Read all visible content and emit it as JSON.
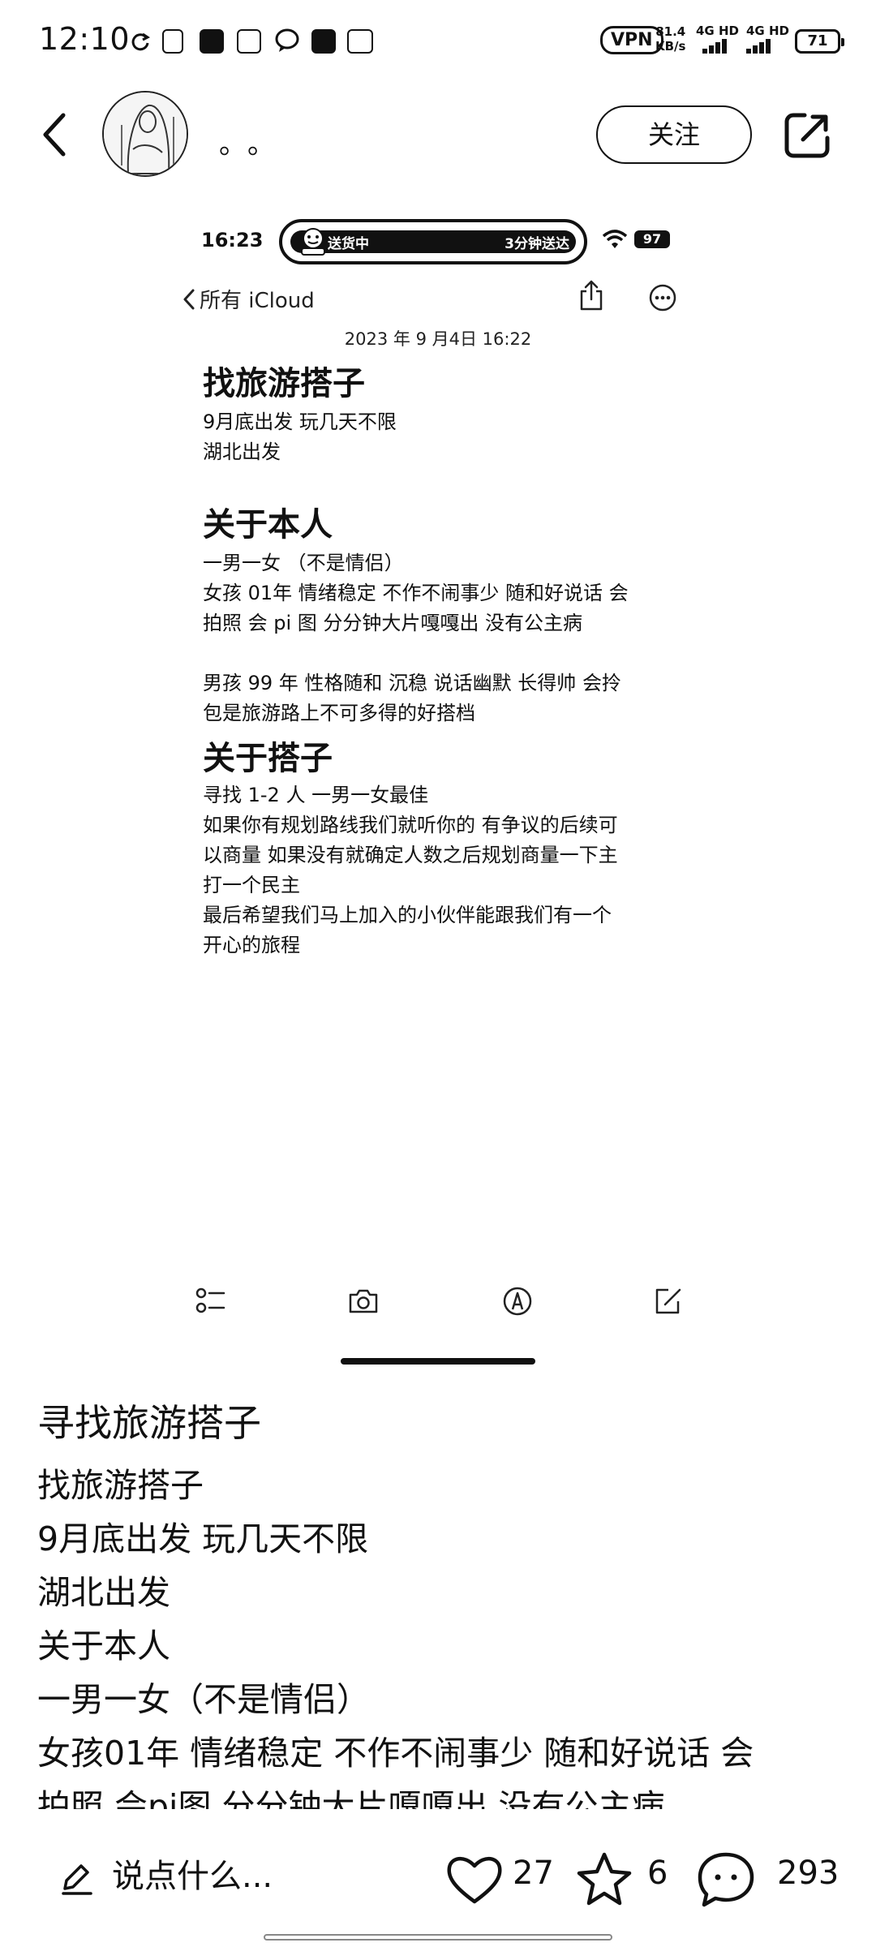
{
  "status_bar": {
    "time": "12:10",
    "vpn": "VPN",
    "speed_value": "81.4",
    "speed_unit": "KB/s",
    "net1": "4G HD",
    "net2": "4G HD",
    "battery": "71"
  },
  "header": {
    "author_name": "。。",
    "follow_label": "关注"
  },
  "inner_screenshot": {
    "time": "16:23",
    "island_left": "送货中",
    "island_right": "3分钟送达",
    "battery": "97",
    "back_label": "所有 iCloud",
    "date": "2023 年 9 月4日 16:22",
    "sections": [
      {
        "heading": "找旅游搭子",
        "lines": [
          "9月底出发 玩几天不限",
          "湖北出发"
        ]
      },
      {
        "heading": "关于本人",
        "lines": [
          "一男一女 （不是情侣）",
          "女孩 01年 情绪稳定 不作不闹事少 随和好说话 会",
          "拍照 会 pi 图 分分钟大片嘎嘎出 没有公主病",
          "",
          "男孩 99 年 性格随和 沉稳 说话幽默 长得帅 会拎",
          "包是旅游路上不可多得的好搭档"
        ]
      },
      {
        "heading": "关于搭子",
        "lines": [
          "寻找 1-2 人 一男一女最佳",
          "如果你有规划路线我们就听你的 有争议的后续可",
          "以商量 如果没有就确定人数之后规划商量一下主",
          "打一个民主",
          "最后希望我们马上加入的小伙伴能跟我们有一个",
          "开心的旅程"
        ]
      }
    ]
  },
  "post": {
    "title": "寻找旅游搭子",
    "body_lines": [
      "找旅游搭子",
      "9月底出发 玩几天不限",
      "湖北出发",
      "关于本人",
      "一男一女（不是情侣）",
      "女孩01年 情绪稳定 不作不闹事少 随和好说话 会",
      "拍照 会pi图 分分钟大片嘎嘎出 没有公主病"
    ]
  },
  "bottom_bar": {
    "comment_placeholder": "说点什么...",
    "likes": "27",
    "favorites": "6",
    "comments": "293"
  }
}
